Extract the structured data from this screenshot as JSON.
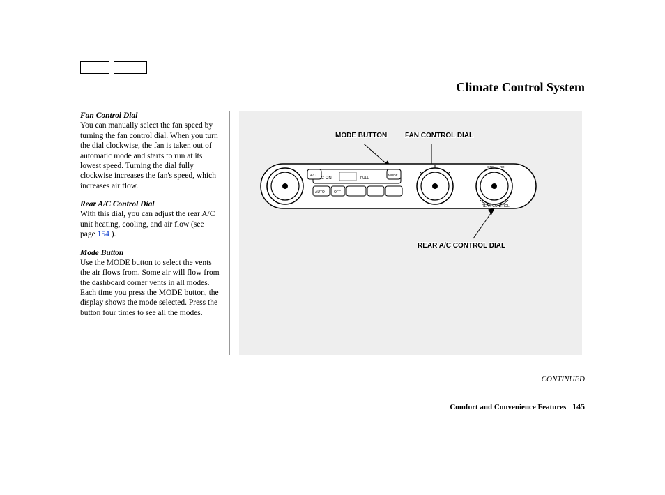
{
  "header": {
    "title": "Climate Control System"
  },
  "sections": {
    "fan": {
      "title": "Fan Control Dial",
      "body": "You can manually select the fan speed by turning the fan control dial. When you turn the dial clockwise, the fan is taken out of automatic mode and starts to run at its lowest speed. Turning the dial fully clockwise increases the fan's speed, which increases air flow."
    },
    "rear": {
      "title": "Rear A/C Control Dial",
      "body_pre": "With this dial, you can adjust the rear A/C unit heating, cooling, and air flow (see page ",
      "page_link": "154",
      "body_post": " )."
    },
    "mode": {
      "title": "Mode Button",
      "body": "Use the MODE button to select the vents the air flows from. Some air will flow from the dashboard corner vents in all modes. Each time you press the MODE button, the display shows the mode selected. Press the button four times to see all the modes."
    }
  },
  "callouts": {
    "mode": "MODE BUTTON",
    "fan": "FAN CONTROL DIAL",
    "rear": "REAR A/C CONTROL DIAL"
  },
  "continued": "CONTINUED",
  "footer": {
    "section": "Comfort and Convenience Features",
    "page": "145"
  }
}
